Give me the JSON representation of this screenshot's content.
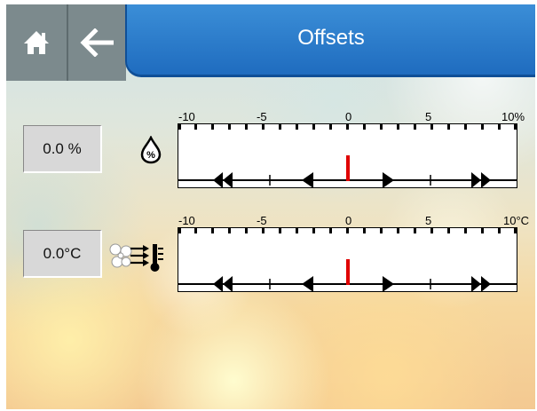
{
  "header": {
    "title": "Offsets",
    "home_icon": "home-icon",
    "back_icon": "back-arrow-icon"
  },
  "humidity_offset": {
    "value": "0.0 %",
    "icon": "humidity-drop-icon",
    "scale_labels": [
      "-10",
      "-5",
      "0",
      "5",
      "10%"
    ],
    "current_offset": 0,
    "range": [
      -10,
      10
    ],
    "marker_color": "#e00000"
  },
  "temperature_offset": {
    "value": "0.0°C",
    "icon": "fan-temperature-icon",
    "scale_labels": [
      "-10",
      "-5",
      "0",
      "5",
      "10°C"
    ],
    "current_offset": 0,
    "range": [
      -10,
      10
    ],
    "marker_color": "#e00000"
  },
  "colors": {
    "title_bar": "#2a7bcb",
    "nav_panel": "#7c8a8d"
  }
}
